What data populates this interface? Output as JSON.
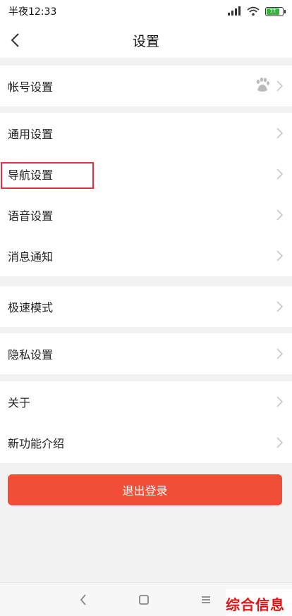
{
  "status_bar": {
    "time": "半夜12:33",
    "battery": "77"
  },
  "header": {
    "title": "设置"
  },
  "groups": [
    {
      "items": [
        {
          "label": "帐号设置"
        }
      ]
    },
    {
      "items": [
        {
          "label": "通用设置"
        },
        {
          "label": "导航设置"
        },
        {
          "label": "语音设置"
        },
        {
          "label": "消息通知"
        }
      ]
    },
    {
      "items": [
        {
          "label": "极速模式"
        }
      ]
    },
    {
      "items": [
        {
          "label": "隐私设置"
        }
      ]
    },
    {
      "items": [
        {
          "label": "关于"
        },
        {
          "label": "新功能介绍"
        }
      ]
    }
  ],
  "logout_label": "退出登录",
  "watermark": "综合信息",
  "colors": {
    "accent": "#f04e36",
    "highlight": "#d9363e"
  },
  "icons": {
    "back": "chevron-left-icon",
    "row_arrow": "chevron-right-icon",
    "account_avatar": "baidu-paw-icon"
  }
}
